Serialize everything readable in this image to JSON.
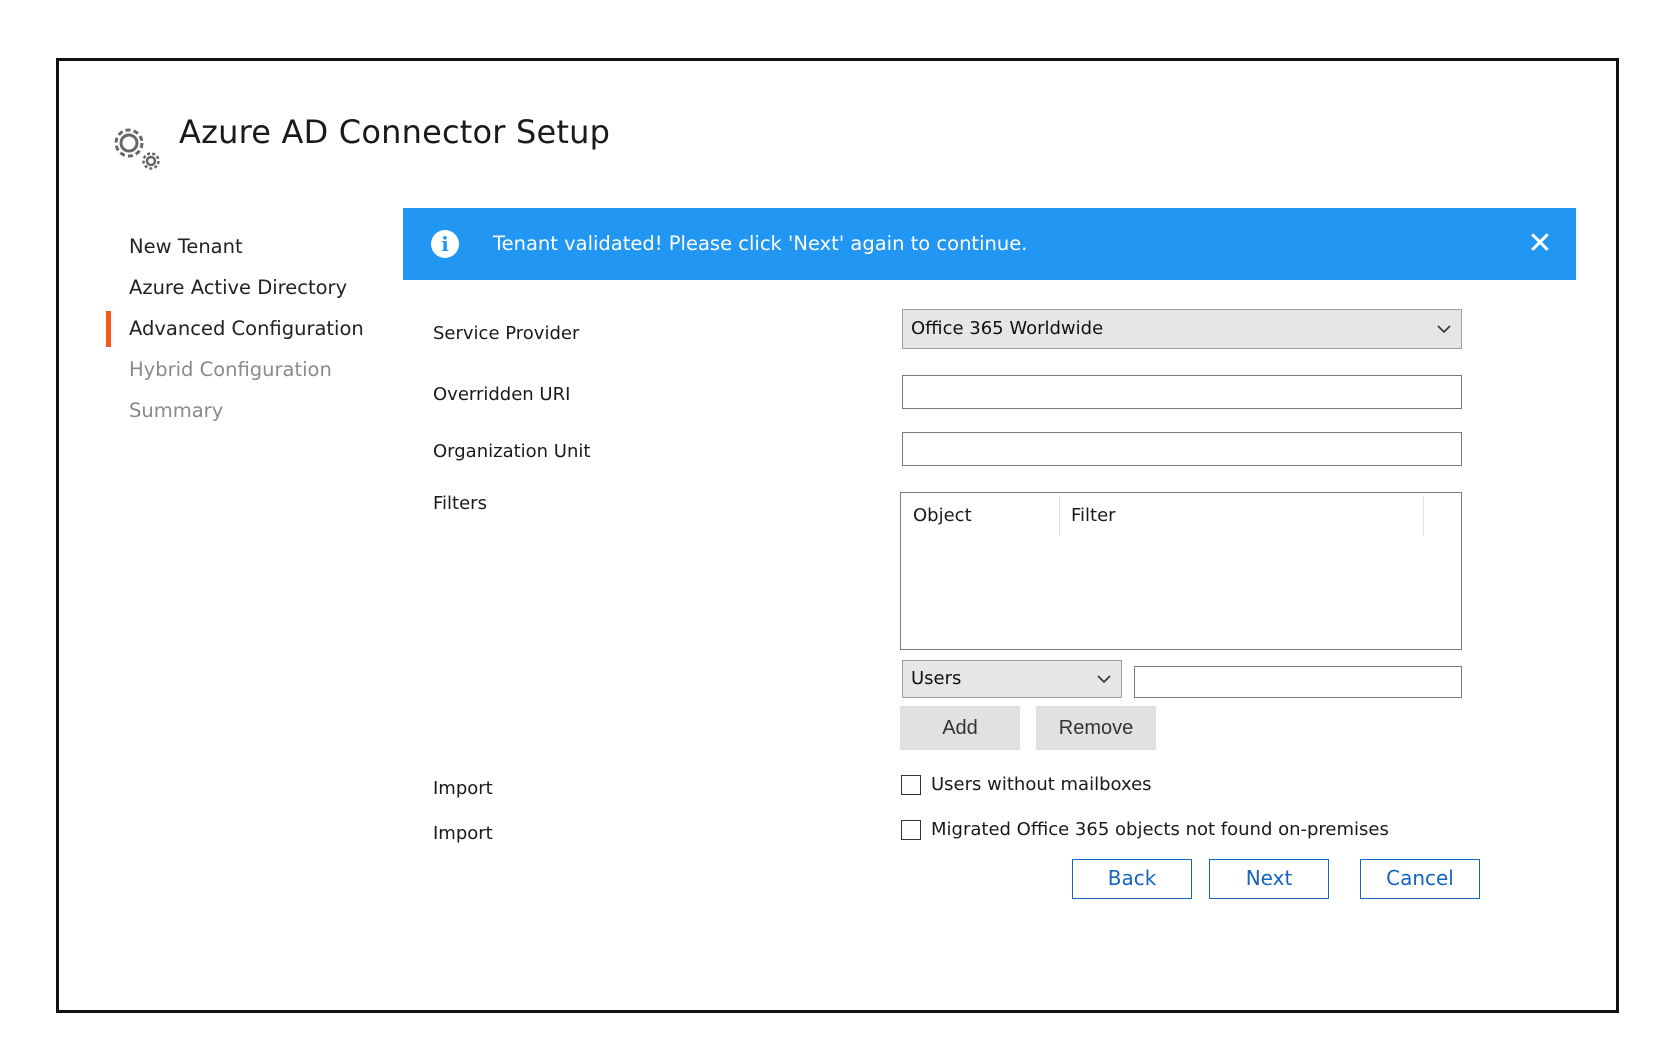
{
  "dialog": {
    "title": "Azure AD Connector Setup",
    "icon": "gears-icon"
  },
  "steps": [
    {
      "label": "New Tenant",
      "state": "done"
    },
    {
      "label": "Azure Active Directory",
      "state": "done"
    },
    {
      "label": "Advanced Configuration",
      "state": "active"
    },
    {
      "label": "Hybrid Configuration",
      "state": "pending"
    },
    {
      "label": "Summary",
      "state": "pending"
    }
  ],
  "banner": {
    "message": "Tenant validated! Please click 'Next' again to continue.",
    "icon": "info-icon",
    "close_icon": "close-icon",
    "color": "#2196f3"
  },
  "form": {
    "service_provider": {
      "label": "Service Provider",
      "value": "Office 365 Worldwide"
    },
    "overridden_uri": {
      "label": "Overridden URI",
      "value": ""
    },
    "organization_unit": {
      "label": "Organization Unit",
      "value": ""
    },
    "filters": {
      "label": "Filters",
      "columns": [
        "Object",
        "Filter"
      ],
      "rows": [],
      "object_select": "Users",
      "filter_value": "",
      "add_label": "Add",
      "remove_label": "Remove"
    },
    "import_1": {
      "label": "Import",
      "checkbox_label": "Users without mailboxes",
      "checked": false
    },
    "import_2": {
      "label": "Import",
      "checkbox_label": "Migrated Office 365 objects not found on-premises",
      "checked": false
    }
  },
  "footer": {
    "back": "Back",
    "next": "Next",
    "cancel": "Cancel",
    "accent": "#1565c0"
  },
  "accent_step_marker": "#f05a22"
}
